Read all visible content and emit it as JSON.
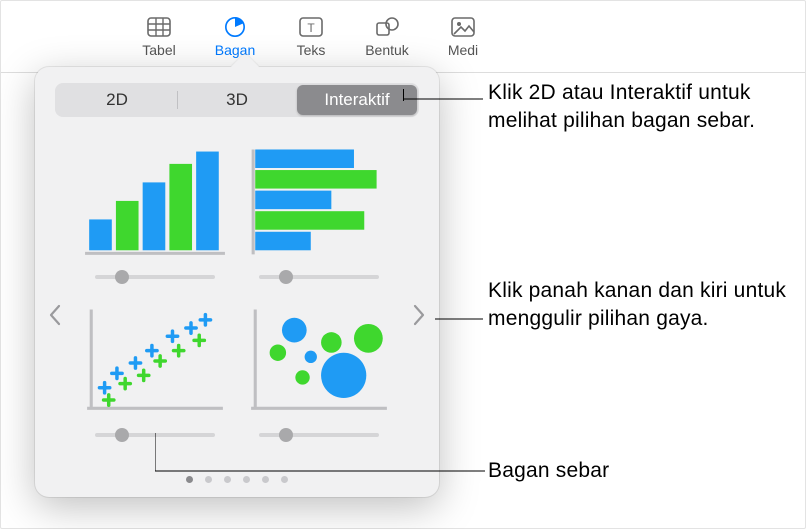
{
  "toolbar": {
    "tabel": {
      "label": "Tabel"
    },
    "bagan": {
      "label": "Bagan"
    },
    "teks": {
      "label": "Teks"
    },
    "bentuk": {
      "label": "Bentuk"
    },
    "media": {
      "label": "Medi"
    }
  },
  "popover": {
    "segments": {
      "d2": "2D",
      "d3": "3D",
      "int": "Interaktif"
    },
    "page_count": 6,
    "current_page": 1,
    "charts": {
      "bar": "interactive-column-chart",
      "hbar": "interactive-bar-chart",
      "scatter": "interactive-scatter-chart",
      "bubble": "interactive-bubble-chart"
    }
  },
  "callouts": {
    "segments": "Klik 2D atau Interaktif untuk melihat pilihan bagan sebar.",
    "arrows": "Klik panah kanan dan kiri untuk menggulir pilihan gaya.",
    "scatter": "Bagan sebar"
  },
  "colors": {
    "blue": "#1f9bf4",
    "green": "#3fd72e",
    "grey": "#b9b9bc"
  }
}
